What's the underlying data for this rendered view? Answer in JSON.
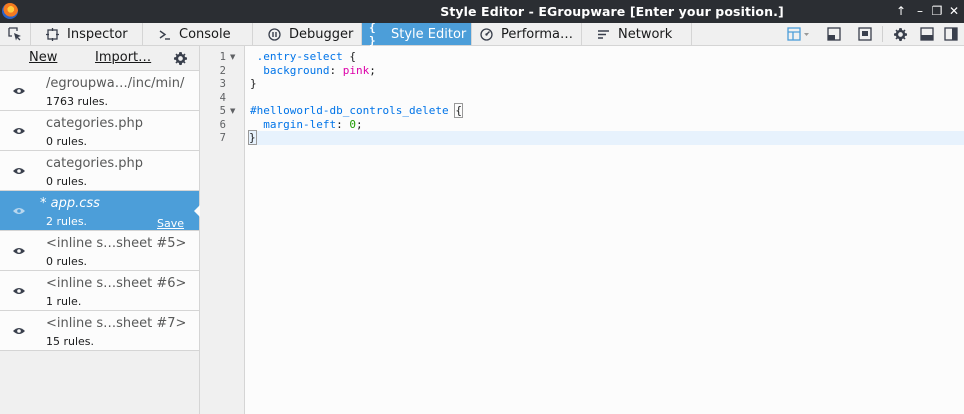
{
  "window": {
    "title": "Style Editor - EGroupware [Enter your position.]",
    "controls": [
      "↑",
      "–",
      "❐",
      "✕"
    ]
  },
  "toolbar": {
    "tabs": [
      {
        "label": "Inspector",
        "icon": "inspector-icon"
      },
      {
        "label": "Console",
        "icon": "console-icon"
      },
      {
        "label": "Debugger",
        "icon": "debugger-icon"
      },
      {
        "label": "Style Editor",
        "icon": "style-editor-icon",
        "selected": true
      },
      {
        "label": "Performa…",
        "icon": "performance-icon"
      },
      {
        "label": "Network",
        "icon": "network-icon"
      }
    ],
    "accent_color": "#4c9ed9"
  },
  "sidebar": {
    "new_label": "New",
    "import_label": "Import…",
    "sheets": [
      {
        "name": "/egroupwa…/inc/min/",
        "rules": "1763 rules."
      },
      {
        "name": "categories.php",
        "rules": "0 rules."
      },
      {
        "name": "categories.php",
        "rules": "0 rules."
      },
      {
        "name": "*  app.css",
        "rules": "2 rules.",
        "save": "Save",
        "selected": true
      },
      {
        "name": "<inline s…sheet #5>",
        "rules": "0 rules."
      },
      {
        "name": "<inline s…sheet #6>",
        "rules": "1 rule."
      },
      {
        "name": "<inline s…sheet #7>",
        "rules": "15 rules."
      }
    ]
  },
  "editor": {
    "line_numbers": [
      "1",
      "2",
      "3",
      "4",
      "5",
      "6",
      "7"
    ],
    "lines": [
      {
        "selector": ".entry-select",
        "rest": " {"
      },
      {
        "prop": "background",
        "sep": ": ",
        "value": "pink",
        "end": ";"
      },
      {
        "text": "}"
      },
      {
        "text": ""
      },
      {
        "selector": "#helloworld-db_controls_delete",
        "rest": " {"
      },
      {
        "prop": "margin-left",
        "sep": ": ",
        "num": "0",
        "end": ";"
      },
      {
        "text": "}"
      }
    ]
  }
}
